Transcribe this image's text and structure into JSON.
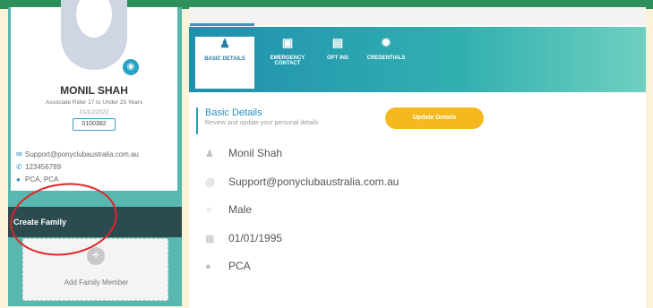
{
  "profile": {
    "name": "MONIL SHAH",
    "role": "Associate Rider 17 to Under 25 Years",
    "date": "01/12/2022",
    "member_id": "0100382",
    "email": "Support@ponyclubaustralia.com.au",
    "phone": "123456789",
    "location": "PCA, PCA"
  },
  "family": {
    "create_label": "Create Family",
    "add_label": "Add Family Member"
  },
  "tabs": [
    {
      "label": "BASIC DETAILS",
      "icon": "person-icon"
    },
    {
      "label": "EMERGENCY CONTACT",
      "icon": "contact-card-icon"
    },
    {
      "label": "OPT INS",
      "icon": "document-icon"
    },
    {
      "label": "CREDENTIALS",
      "icon": "badge-icon"
    }
  ],
  "details": {
    "title": "Basic Details",
    "subtitle": "Review and update your personal details",
    "update_button": "Update Details",
    "name": "Monil Shah",
    "email": "Support@ponyclubaustralia.com.au",
    "gender": "Male",
    "dob": "01/01/1995",
    "club": "PCA"
  },
  "colors": {
    "accent": "#2a9fbc",
    "sidebar": "#58b7ae",
    "update_button": "#f5b81e",
    "annotation_circle": "#e0252a"
  }
}
